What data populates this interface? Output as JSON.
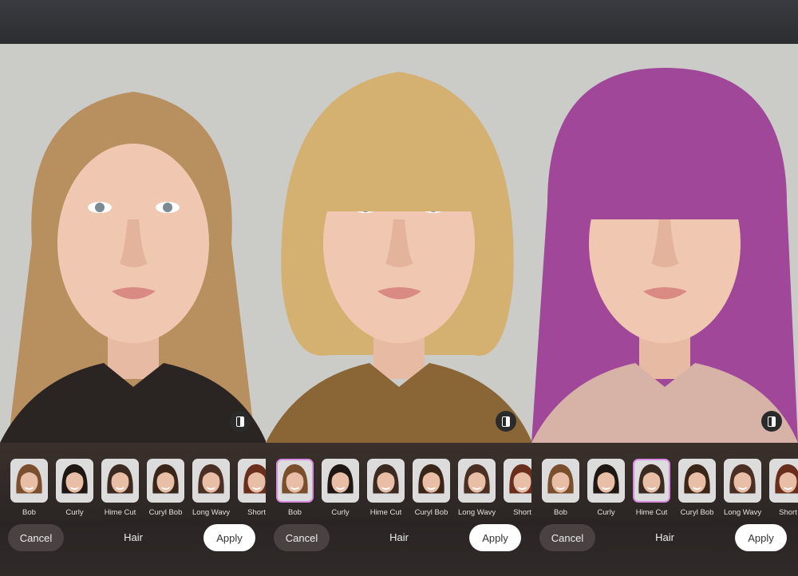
{
  "styles": [
    "Bob",
    "Curly",
    "Hime Cut",
    "Curyl Bob",
    "Long Wavy",
    "Short"
  ],
  "style_hair_colors": [
    "#7a4f2e",
    "#1e1714",
    "#3b2a20",
    "#3a2619",
    "#4a3024",
    "#6a2e1c"
  ],
  "actions": {
    "cancel": "Cancel",
    "title": "Hair",
    "apply": "Apply"
  },
  "panels": [
    {
      "selected": -1,
      "hair_color": "#b88f5e",
      "hair_style": "long",
      "shirt": "#2a2423"
    },
    {
      "selected": 0,
      "hair_color": "#d4b170",
      "hair_style": "bob",
      "shirt": "#8a6535"
    },
    {
      "selected": 2,
      "hair_color": "#a0479a",
      "hair_style": "hime",
      "shirt": "#d7b2a6"
    }
  ]
}
